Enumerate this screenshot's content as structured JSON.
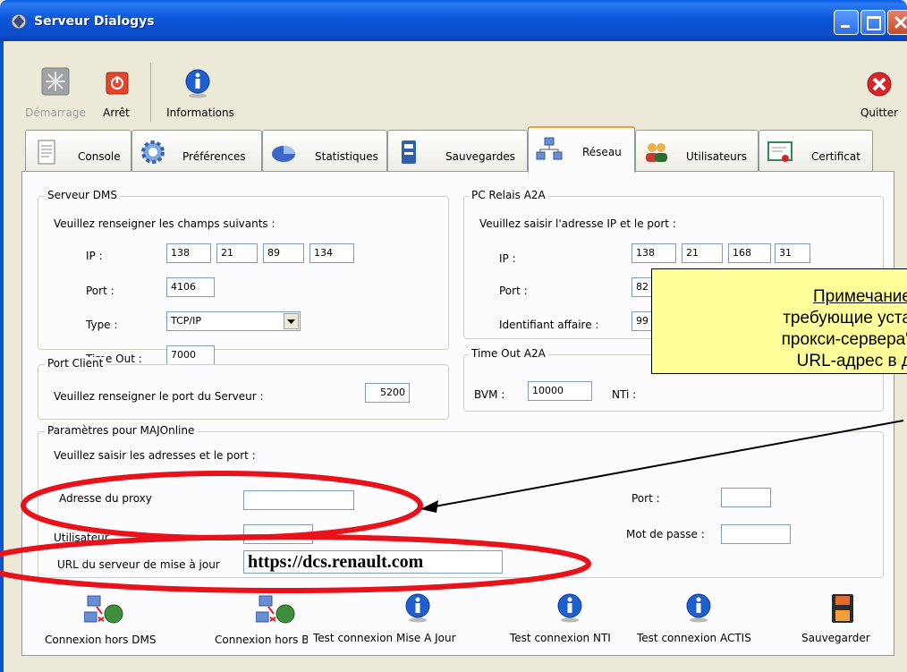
{
  "window": {
    "title": "Serveur Dialogys"
  },
  "toolbar": {
    "start_label": "Démarrage",
    "stop_label": "Arrêt",
    "info_label": "Informations",
    "quit_label": "Quitter"
  },
  "tabs": [
    {
      "label": "Console",
      "icon": "document-icon"
    },
    {
      "label": "Préférences",
      "icon": "gear-icon"
    },
    {
      "label": "Statistiques",
      "icon": "pie-chart-icon"
    },
    {
      "label": "Sauvegardes",
      "icon": "backup-icon"
    },
    {
      "label": "Réseau",
      "icon": "network-icon",
      "active": true
    },
    {
      "label": "Utilisateurs",
      "icon": "users-icon"
    },
    {
      "label": "Certificat",
      "icon": "certificate-icon"
    }
  ],
  "serveur_dms": {
    "title": "Serveur DMS",
    "instruction": "Veuillez renseigner les champs suivants :",
    "ip_label": "IP :",
    "ip": [
      "138",
      "21",
      "89",
      "134"
    ],
    "port_label": "Port :",
    "port": "4106",
    "type_label": "Type :",
    "type": "TCP/IP",
    "timeout_label": "Time Out :",
    "timeout": "7000"
  },
  "port_client": {
    "title": "Port Client",
    "label": "Veuillez renseigner le port du Serveur :",
    "value": "5200"
  },
  "pc_relais": {
    "title": "PC Relais A2A",
    "instruction": "Veuillez saisir l'adresse IP et le port :",
    "ip_label": "IP :",
    "ip": [
      "138",
      "21",
      "168",
      "31"
    ],
    "port_label": "Port :",
    "port": "82",
    "id_label": "Identifiant affaire :",
    "id": "99"
  },
  "timeout_a2a": {
    "title": "Time Out A2A",
    "bvm_label": "BVM :",
    "bvm": "10000",
    "nti_label": "NTi :"
  },
  "majonline": {
    "title": "Paramètres pour MAJOnline",
    "instruction": "Veuillez saisir les adresses et le port :",
    "proxy_label": "Adresse du proxy",
    "proxy": "",
    "port_label": "Port :",
    "port": "",
    "user_label": "Utilisateur",
    "user": "",
    "password_label": "Mot de passe :",
    "password": "",
    "url_label": "URL du serveur de mise à jour",
    "url": "https://dcs.renault.com"
  },
  "buttons": {
    "cnx_dms": "Connexion hors DMS",
    "cnx_bvm": "Connexion hors BVM",
    "test_maj": "Test connexion Mise A Jour",
    "test_nti": "Test connexion NTI",
    "test_actis": "Test connexion ACTIS",
    "save": "Sauvegarder"
  },
  "callout": {
    "line1": "Примечание",
    "line2": "требующие уста",
    "line3": "прокси-сервера\"",
    "line4": "URL-адрес в д"
  },
  "colors": {
    "titlebar": "#0A4CC9",
    "window_bg": "#ECE9D8",
    "callout_bg": "#FFFF99",
    "highlight_ellipse": "#E8131A",
    "active_tab_accent": "#E8A33C"
  }
}
